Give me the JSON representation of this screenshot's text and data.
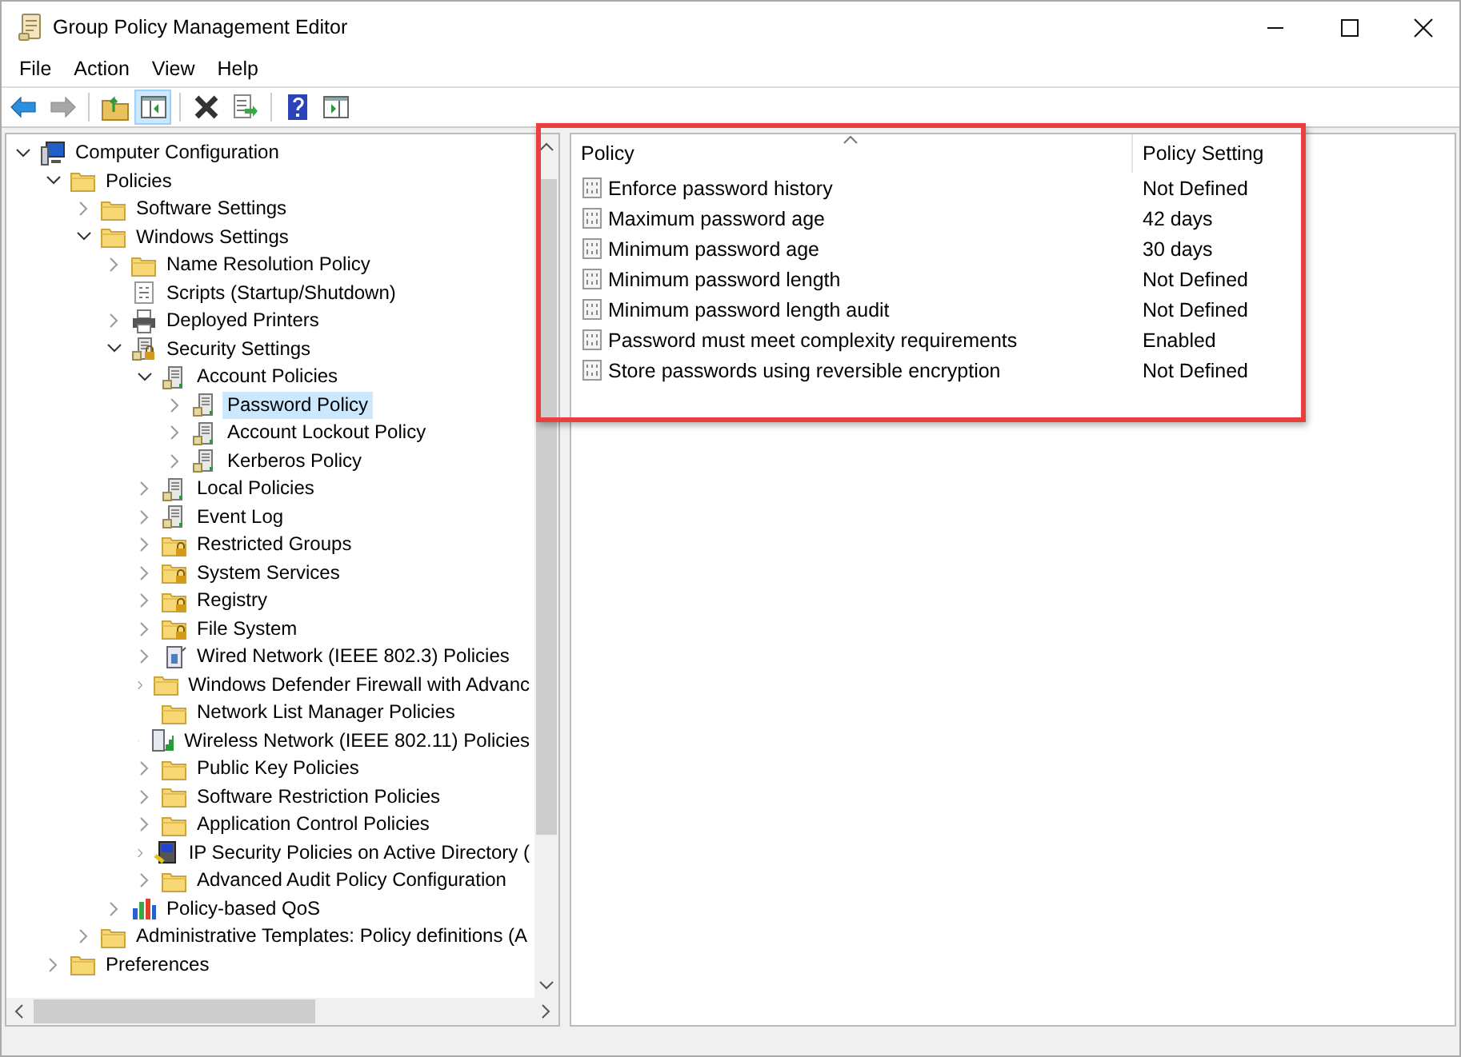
{
  "window": {
    "title": "Group Policy Management Editor"
  },
  "menu": [
    "File",
    "Action",
    "View",
    "Help"
  ],
  "toolbar": [
    {
      "kind": "back",
      "pressed": false,
      "disabled": false
    },
    {
      "kind": "forward",
      "pressed": false,
      "disabled": true
    },
    {
      "kind": "sep"
    },
    {
      "kind": "up",
      "pressed": false,
      "disabled": false
    },
    {
      "kind": "tree",
      "pressed": true,
      "disabled": false
    },
    {
      "kind": "sep"
    },
    {
      "kind": "delete",
      "pressed": false,
      "disabled": false
    },
    {
      "kind": "export",
      "pressed": false,
      "disabled": false
    },
    {
      "kind": "sep"
    },
    {
      "kind": "help",
      "pressed": false,
      "disabled": false
    },
    {
      "kind": "action",
      "pressed": false,
      "disabled": false
    }
  ],
  "tree": [
    {
      "label": "Computer Configuration",
      "kind": "computer",
      "expanded": true,
      "selected": false,
      "children": [
        {
          "label": "Policies",
          "kind": "folder",
          "expanded": true,
          "selected": false,
          "children": [
            {
              "label": "Software Settings",
              "kind": "folder",
              "expanded": false,
              "selected": false
            },
            {
              "label": "Windows Settings",
              "kind": "folder",
              "expanded": true,
              "selected": false,
              "children": [
                {
                  "label": "Name Resolution Policy",
                  "kind": "folder",
                  "expanded": false,
                  "selected": false
                },
                {
                  "label": "Scripts (Startup/Shutdown)",
                  "kind": "script",
                  "selected": false
                },
                {
                  "label": "Deployed Printers",
                  "kind": "printer",
                  "expanded": false,
                  "selected": false
                },
                {
                  "label": "Security Settings",
                  "kind": "security",
                  "expanded": true,
                  "selected": false,
                  "children": [
                    {
                      "label": "Account Policies",
                      "kind": "server",
                      "expanded": true,
                      "selected": false,
                      "children": [
                        {
                          "label": "Password Policy",
                          "kind": "server",
                          "expanded": false,
                          "selected": true
                        },
                        {
                          "label": "Account Lockout Policy",
                          "kind": "server",
                          "expanded": false,
                          "selected": false
                        },
                        {
                          "label": "Kerberos Policy",
                          "kind": "server",
                          "expanded": false,
                          "selected": false
                        }
                      ]
                    },
                    {
                      "label": "Local Policies",
                      "kind": "server",
                      "expanded": false,
                      "selected": false
                    },
                    {
                      "label": "Event Log",
                      "kind": "server",
                      "expanded": false,
                      "selected": false
                    },
                    {
                      "label": "Restricted Groups",
                      "kind": "lockfolder",
                      "expanded": false,
                      "selected": false
                    },
                    {
                      "label": "System Services",
                      "kind": "lockfolder",
                      "expanded": false,
                      "selected": false
                    },
                    {
                      "label": "Registry",
                      "kind": "lockfolder",
                      "expanded": false,
                      "selected": false
                    },
                    {
                      "label": "File System",
                      "kind": "lockfolder",
                      "expanded": false,
                      "selected": false
                    },
                    {
                      "label": "Wired Network (IEEE 802.3) Policies",
                      "kind": "wired",
                      "expanded": false,
                      "selected": false
                    },
                    {
                      "label": "Windows Defender Firewall with Advanc",
                      "kind": "folder",
                      "expanded": false,
                      "selected": false
                    },
                    {
                      "label": "Network List Manager Policies",
                      "kind": "folder",
                      "selected": false
                    },
                    {
                      "label": "Wireless Network (IEEE 802.11) Policies",
                      "kind": "wireless",
                      "expanded": false,
                      "selected": false
                    },
                    {
                      "label": "Public Key Policies",
                      "kind": "folder",
                      "expanded": false,
                      "selected": false
                    },
                    {
                      "label": "Software Restriction Policies",
                      "kind": "folder",
                      "expanded": false,
                      "selected": false
                    },
                    {
                      "label": "Application Control Policies",
                      "kind": "folder",
                      "expanded": false,
                      "selected": false
                    },
                    {
                      "label": "IP Security Policies on Active Directory (",
                      "kind": "ipsec",
                      "expanded": false,
                      "selected": false
                    },
                    {
                      "label": "Advanced Audit Policy Configuration",
                      "kind": "folder",
                      "expanded": false,
                      "selected": false
                    }
                  ]
                },
                {
                  "label": "Policy-based QoS",
                  "kind": "qos",
                  "expanded": false,
                  "selected": false
                }
              ]
            },
            {
              "label": "Administrative Templates: Policy definitions (A",
              "kind": "folder",
              "expanded": false,
              "selected": false
            }
          ]
        },
        {
          "label": "Preferences",
          "kind": "folder",
          "expanded": false,
          "selected": false
        }
      ]
    }
  ],
  "table": {
    "highlighted": true,
    "columns": [
      {
        "label": "Policy",
        "sorted": true
      },
      {
        "label": "Policy Setting",
        "sorted": false
      }
    ],
    "rows": [
      {
        "policy": "Enforce password history",
        "setting": "Not Defined"
      },
      {
        "policy": "Maximum password age",
        "setting": "42 days"
      },
      {
        "policy": "Minimum password age",
        "setting": "30 days"
      },
      {
        "policy": "Minimum password length",
        "setting": "Not Defined"
      },
      {
        "policy": "Minimum password length audit",
        "setting": "Not Defined"
      },
      {
        "policy": "Password must meet complexity requirements",
        "setting": "Enabled"
      },
      {
        "policy": "Store passwords using reversible encryption",
        "setting": "Not Defined"
      }
    ]
  }
}
